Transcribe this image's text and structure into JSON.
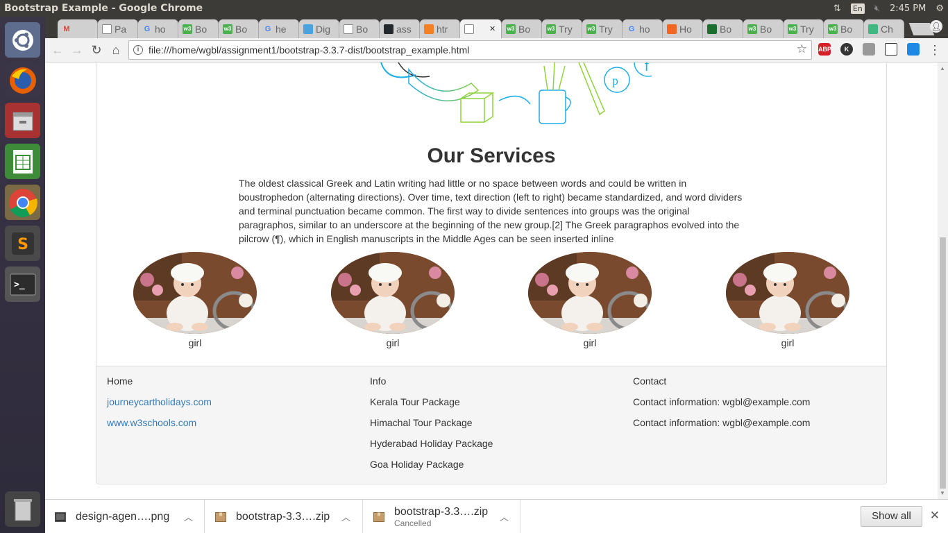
{
  "os": {
    "window_title": "Bootstrap Example - Google Chrome",
    "keyboard_layout": "En",
    "clock": "2:45 PM"
  },
  "tabs": [
    {
      "label": "",
      "icon": "gmail-icon",
      "color": "#d44638"
    },
    {
      "label": "Pa",
      "icon": "page-icon",
      "color": "#888888"
    },
    {
      "label": "ho",
      "icon": "google-icon",
      "color": "#4285f4"
    },
    {
      "label": "Bo",
      "icon": "w3schools-icon",
      "color": "#4caf50"
    },
    {
      "label": "Bo",
      "icon": "w3schools-icon",
      "color": "#4caf50"
    },
    {
      "label": "he",
      "icon": "google-icon",
      "color": "#4285f4"
    },
    {
      "label": "Dig",
      "icon": "loading-icon",
      "color": "#4aa3df"
    },
    {
      "label": "Bo",
      "icon": "page-icon",
      "color": "#888888"
    },
    {
      "label": "ass",
      "icon": "github-icon",
      "color": "#24292e"
    },
    {
      "label": "htr",
      "icon": "stackoverflow-icon",
      "color": "#f48024"
    },
    {
      "label": "",
      "icon": "page-icon",
      "color": "#888888",
      "active": true
    },
    {
      "label": "Bo",
      "icon": "w3schools-icon",
      "color": "#4caf50"
    },
    {
      "label": "Try",
      "icon": "w3schools-icon",
      "color": "#4caf50"
    },
    {
      "label": "Try",
      "icon": "w3schools-icon",
      "color": "#4caf50"
    },
    {
      "label": "ho",
      "icon": "google-icon",
      "color": "#4285f4"
    },
    {
      "label": "Ho",
      "icon": "orange-icon",
      "color": "#f26522"
    },
    {
      "label": "Bo",
      "icon": "green-icon",
      "color": "#1a6e2e"
    },
    {
      "label": "Bo",
      "icon": "w3schools-icon",
      "color": "#4caf50"
    },
    {
      "label": "Try",
      "icon": "w3schools-icon",
      "color": "#4caf50"
    },
    {
      "label": "Bo",
      "icon": "w3schools-icon",
      "color": "#4caf50"
    },
    {
      "label": "Ch",
      "icon": "vue-icon",
      "color": "#41b883"
    }
  ],
  "address_bar": {
    "url": "file:///home/wgbl/assignment1/bootstrap-3.3.7-dist/bootstrap_example.html"
  },
  "extensions": [
    {
      "label": "ABP",
      "color": "#d41f26"
    },
    {
      "label": "K",
      "color": "#333333"
    },
    {
      "label": "",
      "color": "#999999"
    },
    {
      "label": "",
      "color": "#333333"
    },
    {
      "label": "",
      "color": "#1e88e5"
    }
  ],
  "page": {
    "services_title": "Our Services",
    "services_text": "The oldest classical Greek and Latin writing had little or no space between words and could be written in boustrophedon (alternating directions). Over time, text direction (left to right) became standardized, and word dividers and terminal punctuation became common. The first way to divide sentences into groups was the original paragraphos, similar to an underscore at the beginning of the new group.[2] The Greek paragraphos evolved into the pilcrow (¶), which in English manuscripts in the Middle Ages can be seen inserted inline",
    "gallery": [
      {
        "caption": "girl"
      },
      {
        "caption": "girl"
      },
      {
        "caption": "girl"
      },
      {
        "caption": "girl"
      }
    ],
    "footer": {
      "col1": {
        "heading": "Home",
        "links": [
          "journeycartholidays.com",
          "www.w3schools.com"
        ]
      },
      "col2": {
        "heading": "Info",
        "items": [
          "Kerala Tour Package",
          "Himachal Tour Package",
          "Hyderabad Holiday Package",
          "Goa Holiday Package"
        ]
      },
      "col3": {
        "heading": "Contact",
        "items": [
          "Contact information: wgbl@example.com",
          "Contact information: wgbl@example.com"
        ]
      }
    }
  },
  "downloads": [
    {
      "name": "design-agen….png",
      "status": ""
    },
    {
      "name": "bootstrap-3.3….zip",
      "status": ""
    },
    {
      "name": "bootstrap-3.3….zip",
      "status": "Cancelled"
    }
  ],
  "shelf": {
    "show_all": "Show all"
  }
}
